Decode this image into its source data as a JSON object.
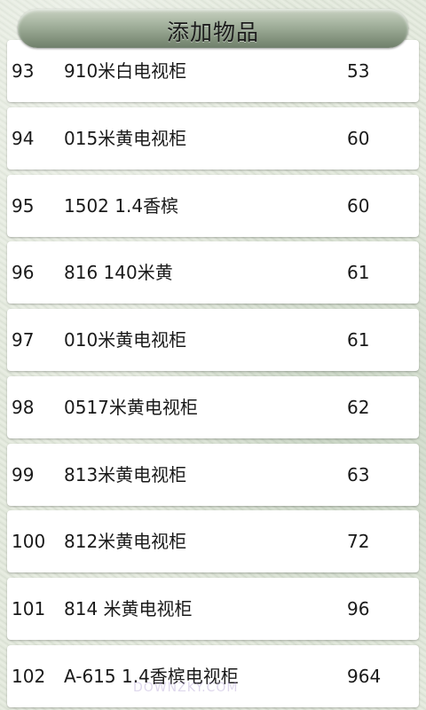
{
  "header": {
    "title": "添加物品"
  },
  "rows": [
    {
      "no": "93",
      "name": "910米白电视柜",
      "qty": "53"
    },
    {
      "no": "94",
      "name": "015米黄电视柜",
      "qty": "60"
    },
    {
      "no": "95",
      "name": "1502  1.4香槟",
      "qty": "60"
    },
    {
      "no": "96",
      "name": "816  140米黄",
      "qty": "61"
    },
    {
      "no": "97",
      "name": "010米黄电视柜",
      "qty": "61"
    },
    {
      "no": "98",
      "name": "0517米黄电视柜",
      "qty": "62"
    },
    {
      "no": "99",
      "name": "813米黄电视柜",
      "qty": "63"
    },
    {
      "no": "100",
      "name": "812米黄电视柜",
      "qty": "72"
    },
    {
      "no": "101",
      "name": "814  米黄电视柜",
      "qty": "96"
    },
    {
      "no": "102",
      "name": "A-615 1.4香槟电视柜",
      "qty": "964"
    }
  ],
  "watermark": "DOWNZKY.COM"
}
